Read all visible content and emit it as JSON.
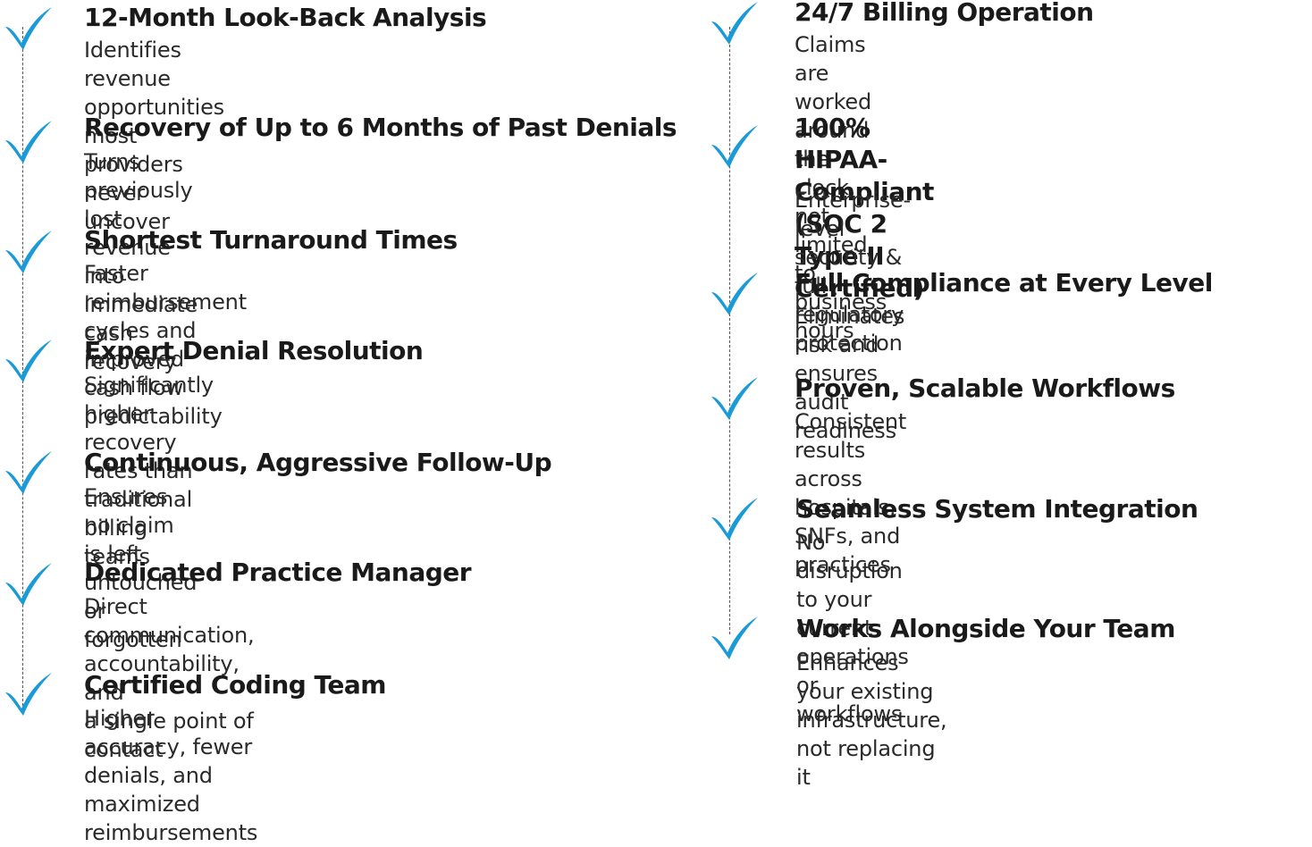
{
  "accent_color": "#1a9ad6",
  "icon": "checkmark-icon",
  "left_column": [
    {
      "title": "12-Month Look-Back Analysis",
      "description": "Identifies revenue opportunities most\nproviders never uncover"
    },
    {
      "title": "Recovery of Up to 6 Months of Past Denials",
      "description": "Turns previously lost revenue into immediate\ncash recovery"
    },
    {
      "title": "Shortest Turnaround Times",
      "description": "Faster reimbursement cycles and improved\ncash flow predictability"
    },
    {
      "title": "Expert Denial Resolution",
      "description": "Significantly higher recovery rates than\ntraditional billing teams"
    },
    {
      "title": "Continuous, Aggressive Follow-Up",
      "description": "Ensures no claim is left untouched\nor forgotten"
    },
    {
      "title": "Dedicated Practice Manager",
      "description": "Direct communication, accountability, and\na single point of contact"
    },
    {
      "title": "Certified Coding Team",
      "description": "Higher accuracy, fewer denials, and\nmaximized reimbursements"
    }
  ],
  "right_column": [
    {
      "title": "24/7 Billing Operation",
      "description": "Claims are worked around the clock,\nnot limited to business hours"
    },
    {
      "title": "100% HIPAA-Compliant\n(SOC 2 Type II Certified)",
      "description": "Enterprise-level security & full\nregulatory protection"
    },
    {
      "title": "Full Compliance at Every Level",
      "description": "Eliminates risk and ensures audit readiness"
    },
    {
      "title": "Proven, Scalable Workflows",
      "description": "Consistent results across hospitals,\nSNFs, and practices"
    },
    {
      "title": "Seamless System Integration",
      "description": "No disruption to your current operations\nor workflows"
    },
    {
      "title": "Works Alongside Your Team",
      "description": "Enhances your existing infrastructure,\nnot replacing it"
    }
  ]
}
